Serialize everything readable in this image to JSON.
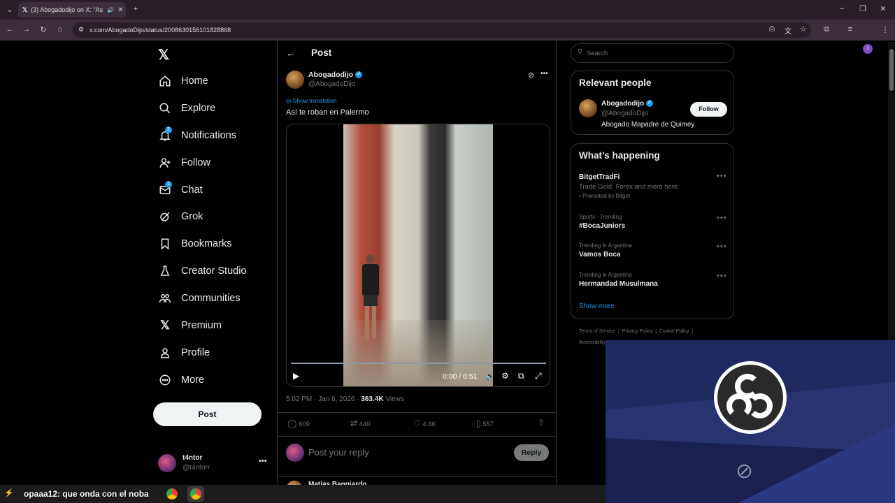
{
  "browser": {
    "tab_title": "(3) Abogadodijo on X: \"Así",
    "url": "x.com/AbogadoDijo/status/2008630156101828868",
    "profile_initial": "I"
  },
  "nav": {
    "items": [
      {
        "label": "Home",
        "icon": "home-icon"
      },
      {
        "label": "Explore",
        "icon": "search-icon"
      },
      {
        "label": "Notifications",
        "icon": "bell-icon"
      },
      {
        "label": "Follow",
        "icon": "follow-icon"
      },
      {
        "label": "Chat",
        "icon": "mail-icon"
      },
      {
        "label": "Grok",
        "icon": "grok-icon"
      },
      {
        "label": "Bookmarks",
        "icon": "bookmark-icon"
      },
      {
        "label": "Creator Studio",
        "icon": "flask-icon"
      },
      {
        "label": "Communities",
        "icon": "people-icon"
      },
      {
        "label": "Premium",
        "icon": "x-icon"
      },
      {
        "label": "Profile",
        "icon": "person-icon"
      },
      {
        "label": "More",
        "icon": "more-circle-icon"
      }
    ],
    "notifications_badge": "2",
    "chat_badge": "1",
    "post_button": "Post",
    "account_name": "t4ntor",
    "account_handle": "@t4ntorr"
  },
  "post": {
    "header_title": "Post",
    "author_name": "Abogadodijo",
    "author_handle": "@AbogadoDijo",
    "show_translation": "Show translation",
    "text": "Así te roban en Palermo",
    "video_time": "0:00 / 0:51",
    "timestamp": "5:02 PM · Jan 6, 2026 ·",
    "views_count": "363.4K",
    "views_label": "Views",
    "replies": "609",
    "reposts": "440",
    "likes": "4.6K",
    "bookmarks": "557",
    "reply_placeholder": "Post your reply",
    "reply_button": "Reply",
    "next_reply_name": "Matías Baggiardo"
  },
  "sidebar": {
    "search_placeholder": "Search",
    "relevant_title": "Relevant people",
    "relevant_name": "Abogadodijo",
    "relevant_handle": "@AbogadoDijo",
    "relevant_bio": "Abogado Mapadre de Quimey",
    "follow_button": "Follow",
    "happening_title": "What’s happening",
    "trends": [
      {
        "context": "",
        "title": "BitgetTradFi",
        "sub": "Trade Gold, Forex and more here",
        "promo": "Promoted by Bitget"
      },
      {
        "context": "Sports · Trending",
        "title": "#BocaJuniors",
        "sub": "",
        "promo": ""
      },
      {
        "context": "Trending in Argentina",
        "title": "Vamos Boca",
        "sub": "",
        "promo": ""
      },
      {
        "context": "Trending in Argentina",
        "title": "Hermandad Musulmana",
        "sub": "",
        "promo": ""
      }
    ],
    "show_more": "Show more",
    "footer": [
      "Terms of Service",
      "Privacy Policy",
      "Cookie Policy",
      "Accessibility"
    ]
  },
  "taskbar": {
    "chat_overlay": "opaaa12: que onda con el noba"
  },
  "colors": {
    "accent": "#1d9bf0",
    "background": "#000000",
    "border": "#2f3336",
    "muted_text": "#71767b",
    "chrome_bg": "#3c2d3a",
    "obs_bg": "#202a60"
  }
}
